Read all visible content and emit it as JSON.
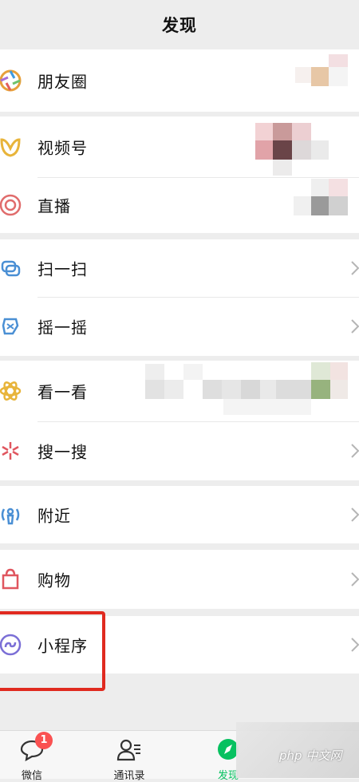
{
  "header": {
    "title": "发现"
  },
  "groups": {
    "g1": [
      "朋友圈"
    ],
    "g2": [
      "视频号",
      "直播"
    ],
    "g3": [
      "扫一扫",
      "摇一摇"
    ],
    "g4": [
      "看一看",
      "搜一搜"
    ],
    "g5": [
      "附近"
    ],
    "g6": [
      "购物"
    ],
    "g7": [
      "小程序"
    ]
  },
  "icons": {
    "moments": "moments-icon",
    "channels": "channels-icon",
    "live": "live-icon",
    "scan": "scan-icon",
    "shake": "shake-icon",
    "top_stories": "top-stories-icon",
    "search": "search-icon",
    "nearby": "nearby-icon",
    "shopping": "shopping-icon",
    "mini_programs": "mini-programs-icon"
  },
  "tabbar": {
    "chats": {
      "label": "微信",
      "badge": "1"
    },
    "contacts": {
      "label": "通讯录"
    },
    "discover": {
      "label": "发现"
    }
  },
  "watermark": {
    "text": "php 中文网"
  },
  "colors": {
    "background": "#ededed",
    "accent": "#07c160",
    "highlight": "#e02a1f",
    "badge": "#fa5151"
  }
}
